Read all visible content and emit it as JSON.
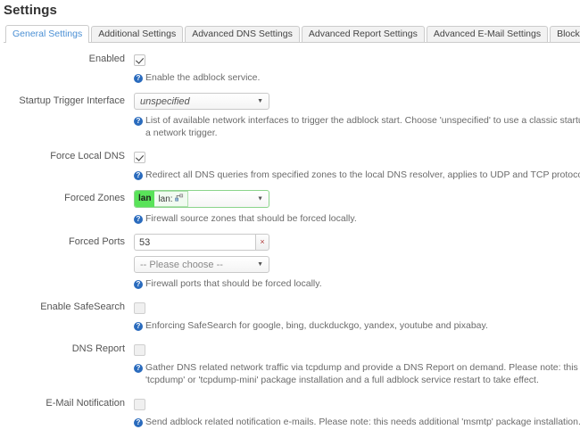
{
  "page": {
    "title": "Settings"
  },
  "tabs": [
    {
      "label": "General Settings",
      "active": true
    },
    {
      "label": "Additional Settings",
      "active": false
    },
    {
      "label": "Advanced DNS Settings",
      "active": false
    },
    {
      "label": "Advanced Report Settings",
      "active": false
    },
    {
      "label": "Advanced E-Mail Settings",
      "active": false
    },
    {
      "label": "Blocklist Sources",
      "active": false
    }
  ],
  "icons": {
    "help": "?",
    "dropdown_arrow": "▼",
    "remove": "×",
    "check": "check-icon",
    "zone_device": "network-device-icon"
  },
  "colors": {
    "accent_blue": "#4a8fd4",
    "help_icon_blue": "#2a6bbd",
    "zone_green": "#59e359",
    "zone_border_green": "#8bd48b",
    "remove_red": "#b03a3a"
  },
  "fields": {
    "enabled": {
      "label": "Enabled",
      "checked": true,
      "help": "Enable the adblock service."
    },
    "startup_trigger_interface": {
      "label": "Startup Trigger Interface",
      "value": "unspecified",
      "help_line1": "List of available network interfaces to trigger the adblock start. Choose 'unspecified' to use a classic startup timeout ins",
      "help_line2": "a network trigger."
    },
    "force_local_dns": {
      "label": "Force Local DNS",
      "checked": true,
      "help": "Redirect all DNS queries from specified zones to the local DNS resolver, applies to UDP and TCP protocol."
    },
    "forced_zones": {
      "label": "Forced Zones",
      "tag": "lan",
      "selection": "lan:",
      "help": "Firewall source zones that should be forced locally."
    },
    "forced_ports": {
      "label": "Forced Ports",
      "value": "53",
      "placeholder": "",
      "choose_placeholder": "-- Please choose --",
      "help": "Firewall ports that should be forced locally."
    },
    "enable_safesearch": {
      "label": "Enable SafeSearch",
      "checked": false,
      "help": "Enforcing SafeSearch for google, bing, duckduckgo, yandex, youtube and pixabay."
    },
    "dns_report": {
      "label": "DNS Report",
      "checked": false,
      "help_line1": "Gather DNS related network traffic via tcpdump and provide a DNS Report on demand. Please note: this needs additio",
      "help_line2": "'tcpdump' or 'tcpdump-mini' package installation and a full adblock service restart to take effect."
    },
    "email_notification": {
      "label": "E-Mail Notification",
      "checked": false,
      "help": "Send adblock related notification e-mails. Please note: this needs additional 'msmtp' package installation."
    }
  }
}
